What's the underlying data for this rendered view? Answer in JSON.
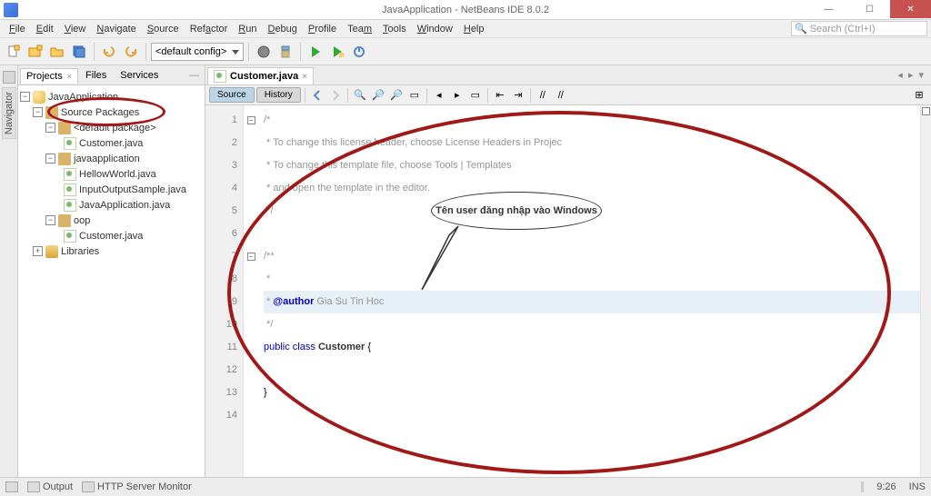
{
  "titlebar": {
    "title": "JavaApplication - NetBeans IDE 8.0.2"
  },
  "menu": [
    "File",
    "Edit",
    "View",
    "Navigate",
    "Source",
    "Refactor",
    "Run",
    "Debug",
    "Profile",
    "Team",
    "Tools",
    "Window",
    "Help"
  ],
  "search_placeholder": "Search (Ctrl+I)",
  "config_label": "<default config>",
  "side_tab": "Navigator",
  "panel_tabs": {
    "projects": "Projects",
    "files": "Files",
    "services": "Services"
  },
  "tree": {
    "root": "JavaApplication",
    "src": "Source Packages",
    "defpkg": "<default package>",
    "customer": "Customer.java",
    "apppkg": "javaapplication",
    "hello": "HellowWorld.java",
    "iosample": "InputOutputSample.java",
    "javaapp": "JavaApplication.java",
    "oop": "oop",
    "customer2": "Customer.java",
    "libs": "Libraries"
  },
  "editor": {
    "tab": "Customer.java",
    "source_btn": "Source",
    "history_btn": "History"
  },
  "code": {
    "l1": "/*",
    "l2": " * To change this license header, choose License Headers in Projec",
    "l3": " * To change this template file, choose Tools | Templates",
    "l4": " * and open the template in the editor.",
    "l5": " */",
    "l6": "",
    "l7": "/**",
    "l8": " *",
    "l9a": " * ",
    "l9tag": "@author",
    "l9b": " Gia Su Tin Hoc",
    "l10": " */",
    "l11a": "public",
    "l11b": " class ",
    "l11c": "Customer",
    "l11d": " {",
    "l12": "",
    "l13": "}",
    "l14": ""
  },
  "callout_text": "Tên user đăng nhập vào Windows",
  "status": {
    "output": "Output",
    "http": "HTTP Server Monitor",
    "time": "9:26",
    "ins": "INS"
  }
}
